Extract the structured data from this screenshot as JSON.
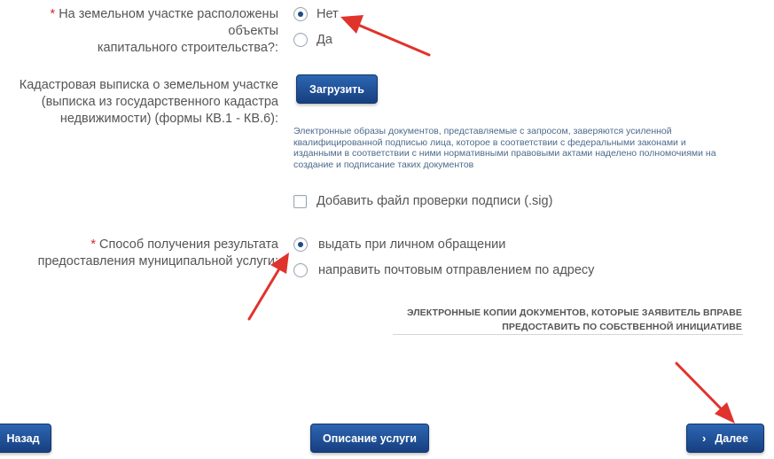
{
  "question_capital": {
    "required_mark": "*",
    "label_line1": "На земельном участке расположены объекты",
    "label_line2": "капитального строительства?:",
    "options": [
      {
        "label": "Нет",
        "checked": true
      },
      {
        "label": "Да",
        "checked": false
      }
    ]
  },
  "cadastral": {
    "label_line1": "Кадастровая выписка о земельном участке",
    "label_line2": "(выписка из государственного кадастра",
    "label_line3": "недвижимости) (формы КВ.1 - КВ.6):",
    "upload_label": "Загрузить",
    "hint_line1": "Электронные образы документов, представляемые с запросом, заверяются усиленной",
    "hint_line2": "квалифицированной подписью лица, которое в соответствии с федеральными законами и",
    "hint_line3": "изданными в соответствии с ними нормативными правовыми актами наделено полномочиями на",
    "hint_line4": "создание и подписание таких документов",
    "sig_checkbox_label": "Добавить файл проверки подписи (.sig)"
  },
  "result_method": {
    "required_mark": "*",
    "label_line1": "Способ получения результата",
    "label_line2": "предоставления муниципальной услуги:",
    "options": [
      {
        "label": "выдать при личном обращении",
        "checked": true
      },
      {
        "label": "направить почтовым отправлением по адресу",
        "checked": false
      }
    ]
  },
  "ecopies": {
    "line1": "ЭЛЕКТРОННЫЕ КОПИИ ДОКУМЕНТОВ, КОТОРЫЕ ЗАЯВИТЕЛЬ ВПРАВЕ",
    "line2": "ПРЕДОСТАВИТЬ ПО СОБСТВЕННОЙ ИНИЦИАТИВЕ"
  },
  "footer": {
    "back_label": "Назад",
    "description_label": "Описание услуги",
    "next_label": "Далее",
    "next_icon": "chevron-right-icon"
  },
  "colors": {
    "accent_blue": "#1c4a86",
    "required_red": "#d9262b",
    "annotation_arrow": "#e0332c",
    "hint_text": "#4c6a8d"
  }
}
